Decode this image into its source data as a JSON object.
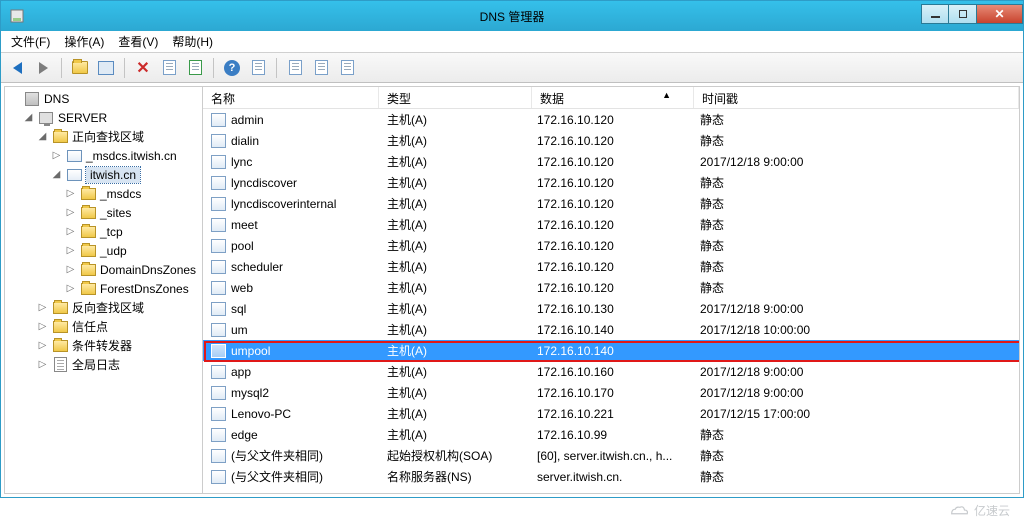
{
  "window": {
    "title": "DNS 管理器"
  },
  "menu": {
    "file": "文件(F)",
    "action": "操作(A)",
    "view": "查看(V)",
    "help": "帮助(H)"
  },
  "tree": {
    "root": "DNS",
    "server": "SERVER",
    "fwd_zone": "正向查找区域",
    "msdcs": "_msdcs.itwish.cn",
    "itwish": "itwish.cn",
    "sub": {
      "msdcs": "_msdcs",
      "sites": "_sites",
      "tcp": "_tcp",
      "udp": "_udp",
      "ddz": "DomainDnsZones",
      "fdz": "ForestDnsZones"
    },
    "rev_zone": "反向查找区域",
    "trust": "信任点",
    "cond_fwd": "条件转发器",
    "global_log": "全局日志"
  },
  "columns": {
    "name": "名称",
    "type": "类型",
    "data": "数据",
    "time": "时间戳"
  },
  "records": [
    {
      "name": "admin",
      "type": "主机(A)",
      "data": "172.16.10.120",
      "time": "静态"
    },
    {
      "name": "dialin",
      "type": "主机(A)",
      "data": "172.16.10.120",
      "time": "静态"
    },
    {
      "name": "lync",
      "type": "主机(A)",
      "data": "172.16.10.120",
      "time": "2017/12/18 9:00:00"
    },
    {
      "name": "lyncdiscover",
      "type": "主机(A)",
      "data": "172.16.10.120",
      "time": "静态"
    },
    {
      "name": "lyncdiscoverinternal",
      "type": "主机(A)",
      "data": "172.16.10.120",
      "time": "静态"
    },
    {
      "name": "meet",
      "type": "主机(A)",
      "data": "172.16.10.120",
      "time": "静态"
    },
    {
      "name": "pool",
      "type": "主机(A)",
      "data": "172.16.10.120",
      "time": "静态"
    },
    {
      "name": "scheduler",
      "type": "主机(A)",
      "data": "172.16.10.120",
      "time": "静态"
    },
    {
      "name": "web",
      "type": "主机(A)",
      "data": "172.16.10.120",
      "time": "静态"
    },
    {
      "name": "sql",
      "type": "主机(A)",
      "data": "172.16.10.130",
      "time": "2017/12/18 9:00:00"
    },
    {
      "name": "um",
      "type": "主机(A)",
      "data": "172.16.10.140",
      "time": "2017/12/18 10:00:00"
    },
    {
      "name": "umpool",
      "type": "主机(A)",
      "data": "172.16.10.140",
      "time": "",
      "selected": true
    },
    {
      "name": "app",
      "type": "主机(A)",
      "data": "172.16.10.160",
      "time": "2017/12/18 9:00:00"
    },
    {
      "name": "mysql2",
      "type": "主机(A)",
      "data": "172.16.10.170",
      "time": "2017/12/18 9:00:00"
    },
    {
      "name": "Lenovo-PC",
      "type": "主机(A)",
      "data": "172.16.10.221",
      "time": "2017/12/15 17:00:00"
    },
    {
      "name": "edge",
      "type": "主机(A)",
      "data": "172.16.10.99",
      "time": "静态"
    },
    {
      "name": "(与父文件夹相同)",
      "type": "起始授权机构(SOA)",
      "data": "[60], server.itwish.cn., h...",
      "time": "静态"
    },
    {
      "name": "(与父文件夹相同)",
      "type": "名称服务器(NS)",
      "data": "server.itwish.cn.",
      "time": "静态"
    }
  ],
  "watermark": "亿速云"
}
